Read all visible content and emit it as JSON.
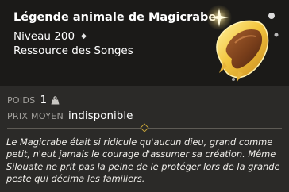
{
  "item": {
    "name": "Légende animale de Magicrabe",
    "level": "Niveau 200",
    "category": "Ressource des Songes",
    "image_icon": "crab-horn-legend-icon"
  },
  "stats": {
    "weight_label": "POIDS",
    "weight_value": "1",
    "weight_icon": "weight-icon",
    "price_label": "PRIX MOYEN",
    "price_value": "indisponible"
  },
  "description": "Le Magicrabe était si ridicule qu'aucun dieu, grand comme petit, n'eut jamais le courage d'assumer sa création. Même Silouate ne prit pas la peine de le protéger lors de la grande peste qui décima les familiers.",
  "colors": {
    "header_bg": "#1b1a18",
    "body_bg": "#2b2a28",
    "label": "#a2a09c",
    "accent_gold": "#c7a53a"
  }
}
